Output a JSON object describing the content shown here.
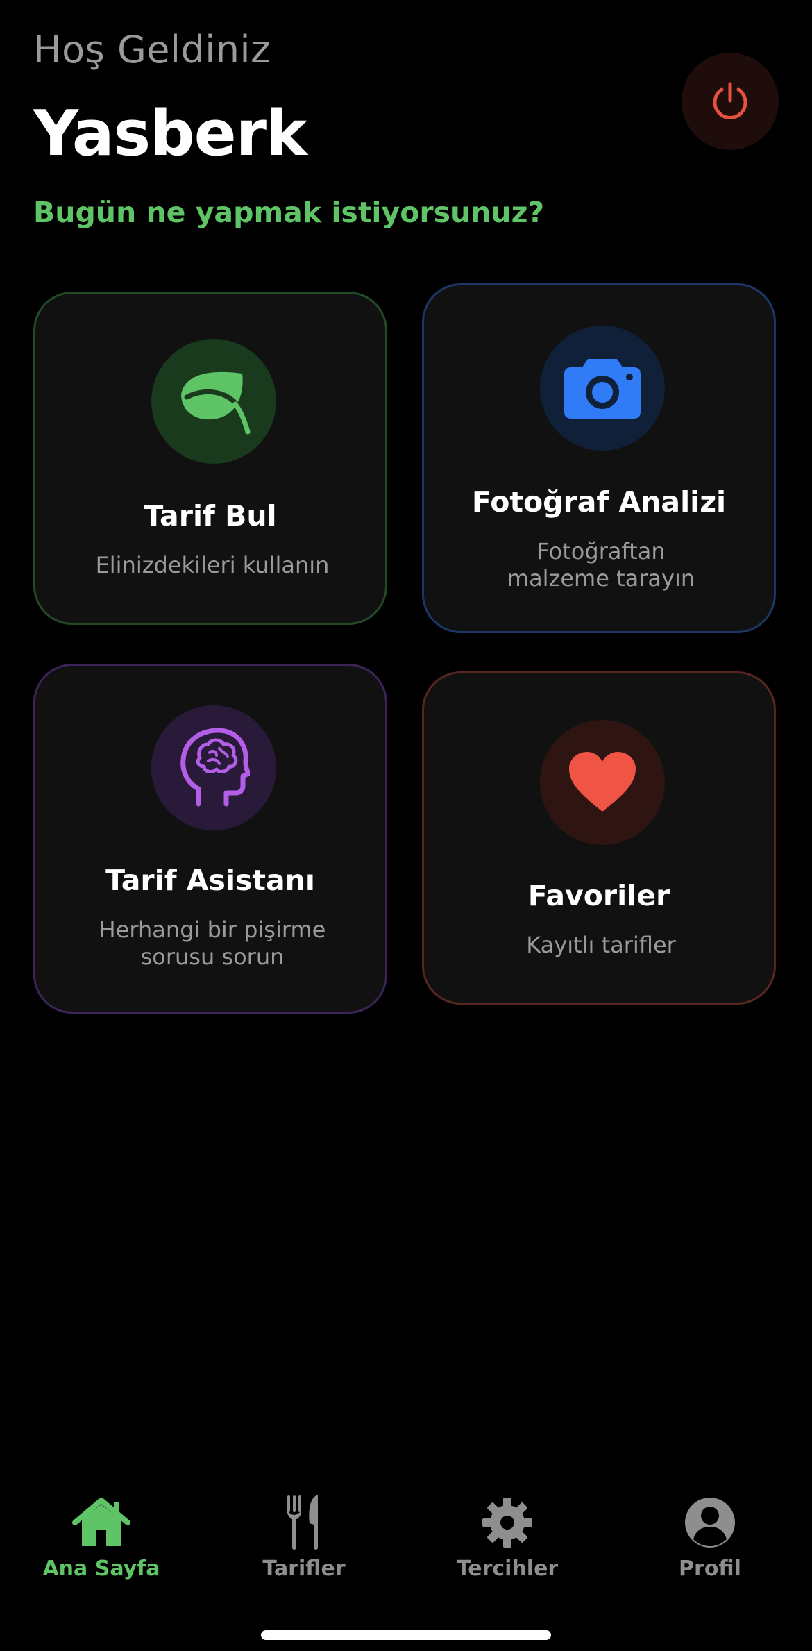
{
  "header": {
    "greeting": "Hoş Geldiniz",
    "username": "Yasberk",
    "prompt": "Bugün ne yapmak istiyorsunuz?",
    "power_icon": "power-icon"
  },
  "cards": {
    "recipe": {
      "title": "Tarif Bul",
      "subtitle": "Elinizdekileri kullanın",
      "icon": "leaf-icon",
      "accent": "#5ec466"
    },
    "photo": {
      "title": "Fotoğraf Analizi",
      "subtitle_line1": "Fotoğraftan",
      "subtitle_line2": "malzeme tarayın",
      "icon": "camera-icon",
      "accent": "#2f7cf6"
    },
    "assistant": {
      "title": "Tarif Asistanı",
      "subtitle_line1": "Herhangi bir pişirme",
      "subtitle_line2": "sorusu sorun",
      "icon": "brain-head-icon",
      "accent": "#b25ee6"
    },
    "favorites": {
      "title": "Favoriler",
      "subtitle": "Kayıtlı tarifler",
      "icon": "heart-icon",
      "accent": "#ef5444"
    }
  },
  "tabbar": {
    "items": [
      {
        "label": "Ana Sayfa",
        "icon": "home-icon",
        "active": true
      },
      {
        "label": "Tarifler",
        "icon": "fork-knife-icon",
        "active": false
      },
      {
        "label": "Tercihler",
        "icon": "gear-icon",
        "active": false
      },
      {
        "label": "Profil",
        "icon": "person-circle-icon",
        "active": false
      }
    ]
  },
  "colors": {
    "background": "#000000",
    "card_background": "#111111",
    "accent_green": "#5ec466",
    "inactive_gray": "#8e8e8e",
    "power_red": "#e5523f"
  }
}
